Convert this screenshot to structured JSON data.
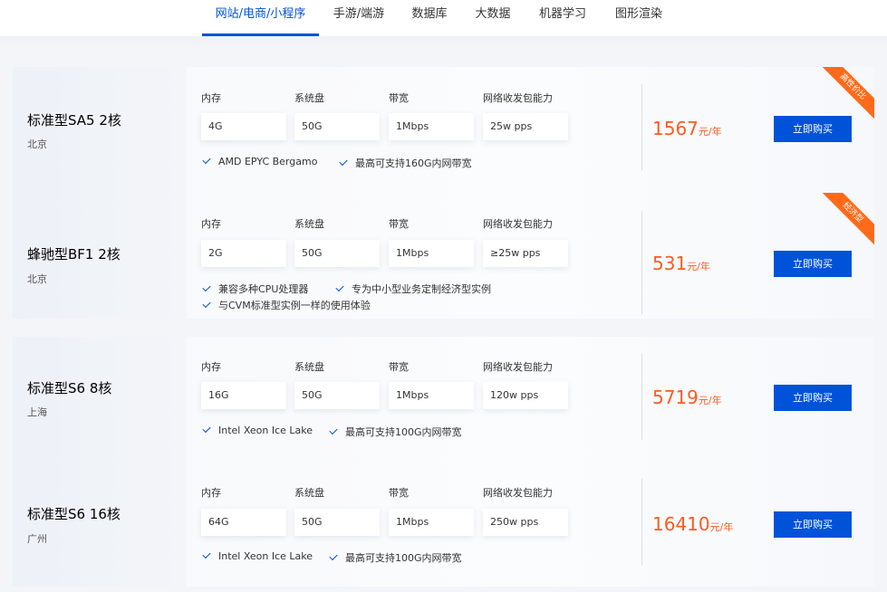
{
  "tabs": [
    "网站/电商/小程序",
    "手游/端游",
    "数据库",
    "大数据",
    "机器学习",
    "图形渲染"
  ],
  "spec_labels": [
    "内存",
    "系统盘",
    "带宽",
    "网络收发包能力"
  ],
  "buy_label": "立即购买",
  "price_unit": "元/年",
  "accent_color": "#0052d9",
  "price_color": "#ff5a1f",
  "cards": [
    {
      "name": "标准型SA5 2核",
      "region": "北京",
      "specs": [
        "4G",
        "50G",
        "1Mbps",
        "25w pps"
      ],
      "features": [
        "AMD EPYC Bergamo",
        "最高可支持160G内网带宽"
      ],
      "price": "1567",
      "ribbon": "高性价比"
    },
    {
      "name": "蜂驰型BF1 2核",
      "region": "北京",
      "specs": [
        "2G",
        "50G",
        "1Mbps",
        "≥25w pps"
      ],
      "features": [
        "兼容多种CPU处理器",
        "专为中小型业务定制经济型实例",
        "与CVM标准型实例一样的使用体验"
      ],
      "price": "531",
      "ribbon": "经济型"
    },
    {
      "name": "标准型S6 8核",
      "region": "上海",
      "specs": [
        "16G",
        "50G",
        "1Mbps",
        "120w pps"
      ],
      "features": [
        "Intel Xeon Ice Lake",
        "最高可支持100G内网带宽"
      ],
      "price": "5719",
      "ribbon": ""
    },
    {
      "name": "标准型S6 16核",
      "region": "广州",
      "specs": [
        "64G",
        "50G",
        "1Mbps",
        "250w pps"
      ],
      "features": [
        "Intel Xeon Ice Lake",
        "最高可支持100G内网带宽"
      ],
      "price": "16410",
      "ribbon": ""
    }
  ]
}
